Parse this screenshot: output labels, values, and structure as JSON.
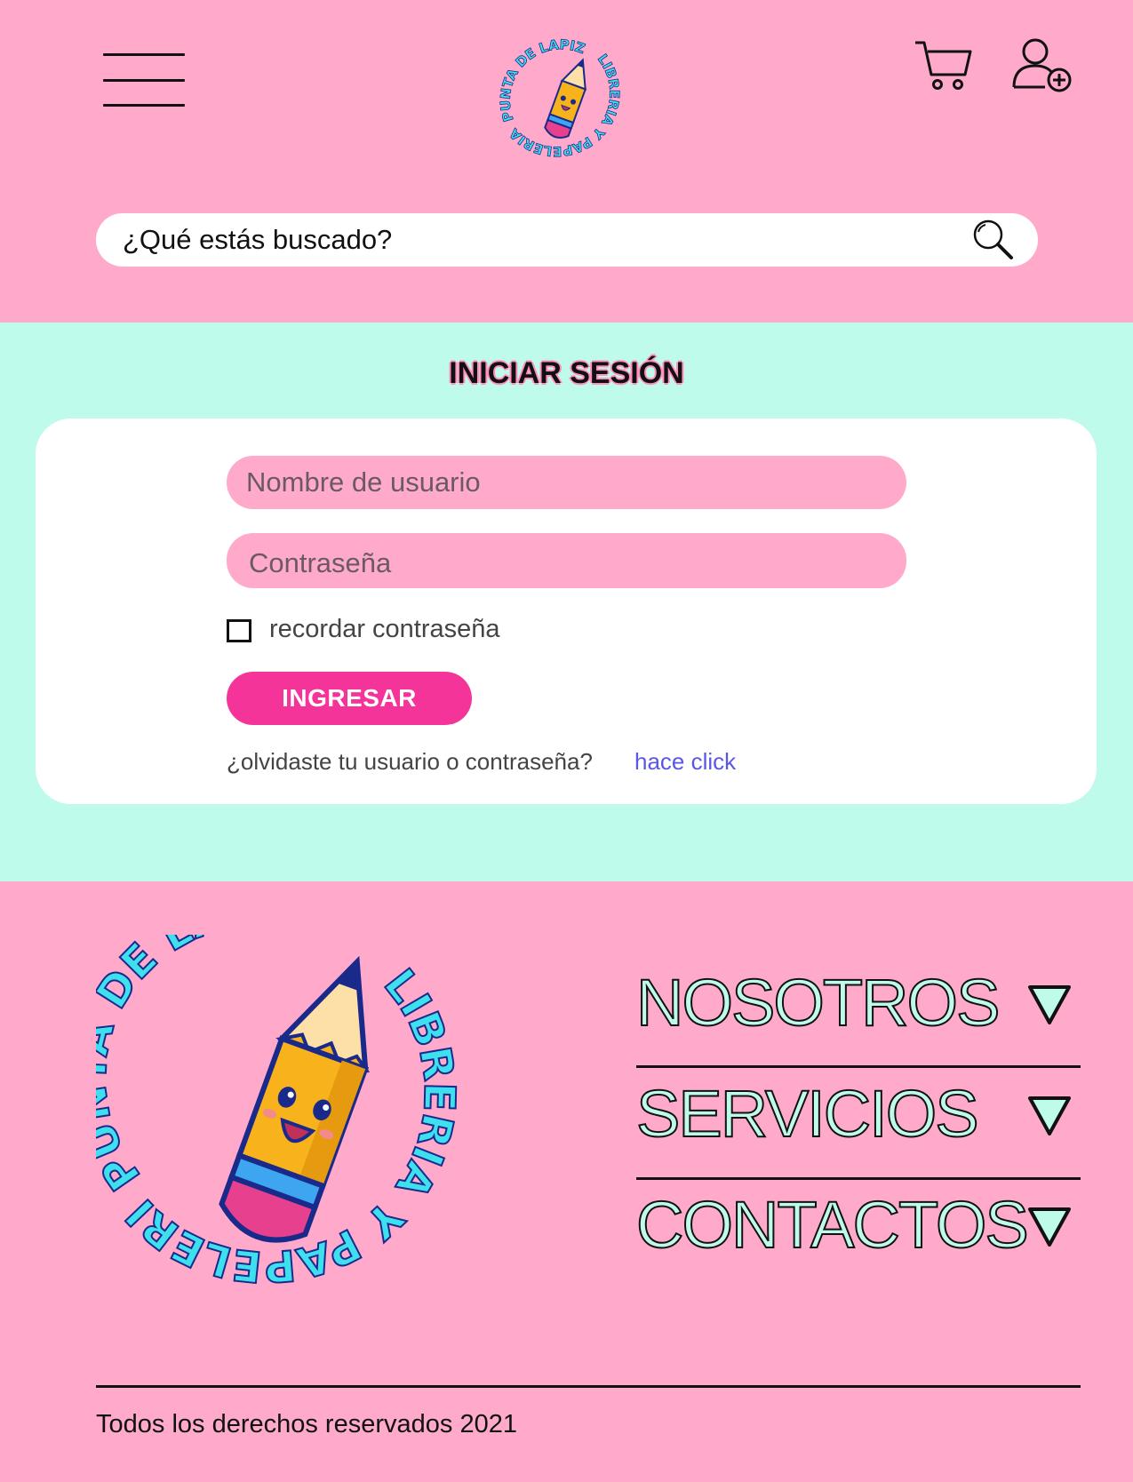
{
  "brand": {
    "logo_text_top": "PUNTA DE LAPIZ",
    "logo_text_bottom": "LIBRERIA Y PAPELERIA"
  },
  "header": {
    "menu_icon": "hamburger-icon",
    "cart_icon": "cart-icon",
    "user_icon": "user-add-icon"
  },
  "search": {
    "placeholder": "¿Qué estás buscado?",
    "icon": "search-icon"
  },
  "login": {
    "title": "INICIAR SESIÓN",
    "username_placeholder": "Nombre de usuario",
    "password_placeholder": "Contraseña",
    "remember_label": "recordar contraseña",
    "submit_label": "INGRESAR",
    "forgot_text": "¿olvidaste tu usuario o contraseña?",
    "forgot_link": "hace click"
  },
  "footer": {
    "menu": [
      {
        "label": "NOSOTROS"
      },
      {
        "label": "SERVICIOS"
      },
      {
        "label": "CONTACTOS"
      }
    ],
    "copyright": "Todos los derechos reservados 2021"
  },
  "colors": {
    "pink_bg": "#ffaacb",
    "mint_bg": "#bffbea",
    "button_pink": "#f5349a",
    "link_blue": "#5b57e6",
    "logo_cyan": "#3ee0f0"
  }
}
